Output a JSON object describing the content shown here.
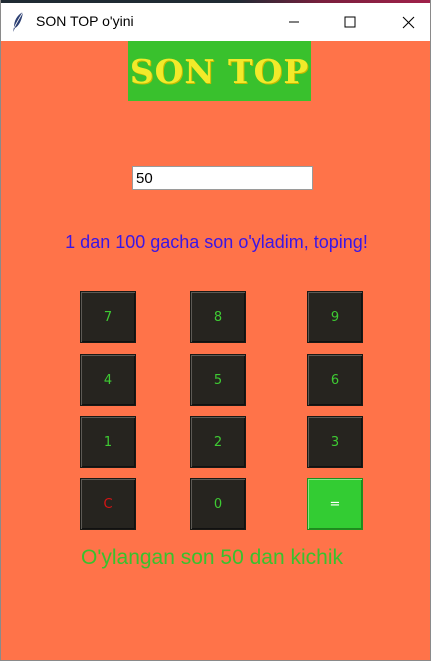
{
  "window": {
    "title": "SON TOP o'yini",
    "icon": "feather-icon"
  },
  "titlebar_controls": {
    "minimize": "minimize-icon",
    "maximize": "maximize-icon",
    "close": "close-icon"
  },
  "logo": {
    "text": "SON TOP"
  },
  "input": {
    "value": "50"
  },
  "prompt": {
    "text": "1 dan 100 gacha son o'yladim, toping!"
  },
  "keypad": {
    "rows": [
      [
        "7",
        "8",
        "9"
      ],
      [
        "4",
        "5",
        "6"
      ],
      [
        "1",
        "2",
        "3"
      ],
      [
        "C",
        "0",
        "="
      ]
    ]
  },
  "result": {
    "text": "O'ylangan son 50 dan kichik"
  },
  "colors": {
    "background": "#ff7349",
    "logo_bg": "#39c12d",
    "logo_text": "#f2ea2a",
    "prompt_text": "#3a16e6",
    "key_bg": "#26241f",
    "key_text": "#3ecb33",
    "clear_text": "#d81414",
    "equals_bg": "#33cc33",
    "result_text": "#39c12d"
  }
}
